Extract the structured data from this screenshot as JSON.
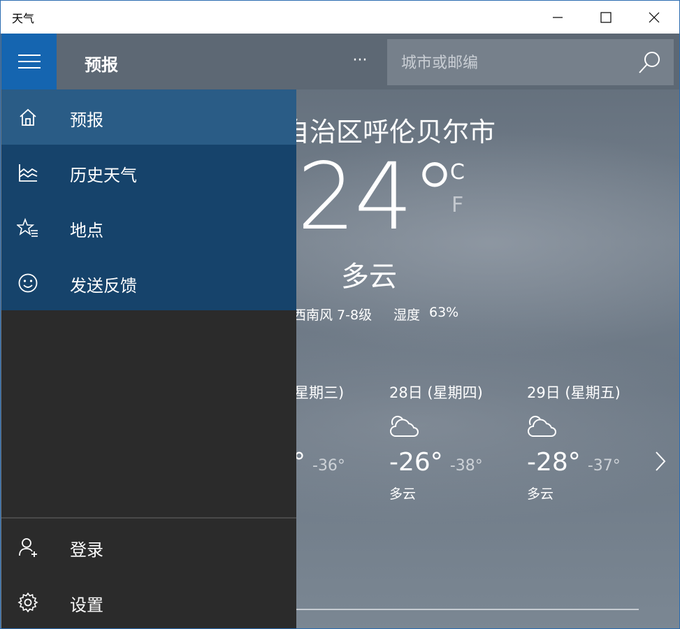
{
  "window": {
    "title": "天气",
    "controls": {
      "minimize": "minimize-icon",
      "maximize": "maximize-icon",
      "close": "close-icon"
    }
  },
  "header": {
    "title": "预报",
    "more_label": "···",
    "search": {
      "placeholder": "城市或邮编",
      "icon": "search-icon"
    }
  },
  "nav": {
    "menu_icon": "hamburger-icon",
    "items": [
      {
        "label": "预报",
        "icon": "home-icon",
        "selected": true
      },
      {
        "label": "历史天气",
        "icon": "history-chart-icon"
      },
      {
        "label": "地点",
        "icon": "favorites-star-icon"
      },
      {
        "label": "发送反馈",
        "icon": "smiley-icon"
      }
    ],
    "bottom": [
      {
        "label": "登录",
        "icon": "add-user-icon"
      },
      {
        "label": "设置",
        "icon": "gear-icon"
      }
    ]
  },
  "current": {
    "location": "自治区呼伦贝尔市",
    "temperature": "24°",
    "unit_c": "C",
    "unit_f": "F",
    "condition": "多云",
    "wind": "西南风 7-8级",
    "humidity_label": "湿度",
    "humidity": "63%"
  },
  "forecast": [
    {
      "date": "星期三)",
      "high": "°",
      "low": "-36°",
      "condition": ""
    },
    {
      "date": "28日 (星期四)",
      "high": "-26°",
      "low": "-38°",
      "condition": "多云",
      "icon": "cloud-icon"
    },
    {
      "date": "29日 (星期五)",
      "high": "-28°",
      "low": "-37°",
      "condition": "多云",
      "icon": "cloud-icon"
    }
  ],
  "colors": {
    "accent": "#1565b0",
    "nav_bg": "#16436b",
    "nav_selected": "#2a5c86",
    "pane_bg": "#2b2b2b"
  }
}
